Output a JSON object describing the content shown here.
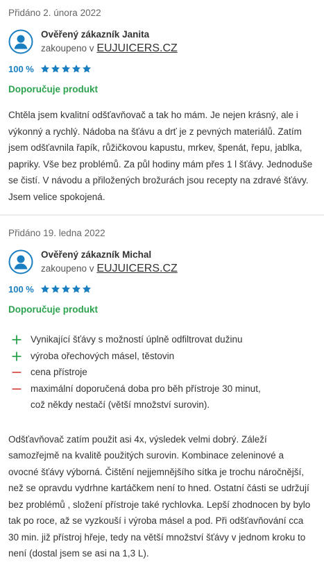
{
  "reviews": [
    {
      "date": "Přidáno 2. února 2022",
      "author": "Ověřený zákazník Janita",
      "bought_prefix": "zakoupeno v ",
      "shop": "EUJUICERS.CZ",
      "rating_percent": "100 %",
      "stars": 5,
      "recommend": "Doporučuje produkt",
      "text": "Chtěla jsem kvalitní odšťavňovač a tak ho mám. Je nejen krásný, ale i výkonný a rychlý. Nádoba na šťávu a drť je z pevných materiálů. Zatím jsem odšťavnila řapík, růžičkovou kapustu, mrkev, špenát, řepu, jablka, papriky. Vše bez problémů. Za půl hodiny mám přes 1 l šťávy. Jednoduše se čistí. V návodu a přiložených brožurách jsou recepty na zdravé šťávy. Jsem velice spokojená."
    },
    {
      "date": "Přidáno 19. ledna 2022",
      "author": "Ověřený zákazník Michal",
      "bought_prefix": "zakoupeno v ",
      "shop": "EUJUICERS.CZ",
      "rating_percent": "100 %",
      "stars": 5,
      "recommend": "Doporučuje produkt",
      "pros": [
        "Vynikající šťávy s možností úplně odfiltrovat dužinu",
        "výroba ořechových másel, těstovin"
      ],
      "cons": [
        "cena přístroje",
        "maximální doporučená doba pro běh přístroje 30 minut, což někdy nestačí (větší množství surovin)."
      ],
      "text": "Odšťavňovač zatím použit asi 4x, výsledek velmi dobrý. Záleží samozřejmě na kvalitě použitých surovin. Kombinace zeleninové a ovocné šťávy výborná. Čištění nejjemnějšího sítka je trochu náročnější, než se opravdu vydrhne kartáčkem není to hned. Ostatní části se udržují bez problémů , složení přístroje také rychlovka. Lepší zhodnocen by bylo tak po roce, až se vyzkouší i výroba másel a pod. Při odšťavňování cca 30 min. již přístroj hřeje, tedy na větší množství šťávy v jednom kroku to není (dostal jsem se asi na 1,3 L)."
    }
  ],
  "icons": {
    "avatar": "user-avatar-icon",
    "star": "star-icon",
    "pro": "plus-icon",
    "con": "minus-icon"
  },
  "colors": {
    "accent_blue": "#1a7fc1",
    "recommend_green": "#2ca24e",
    "con_red": "#d9534f"
  }
}
